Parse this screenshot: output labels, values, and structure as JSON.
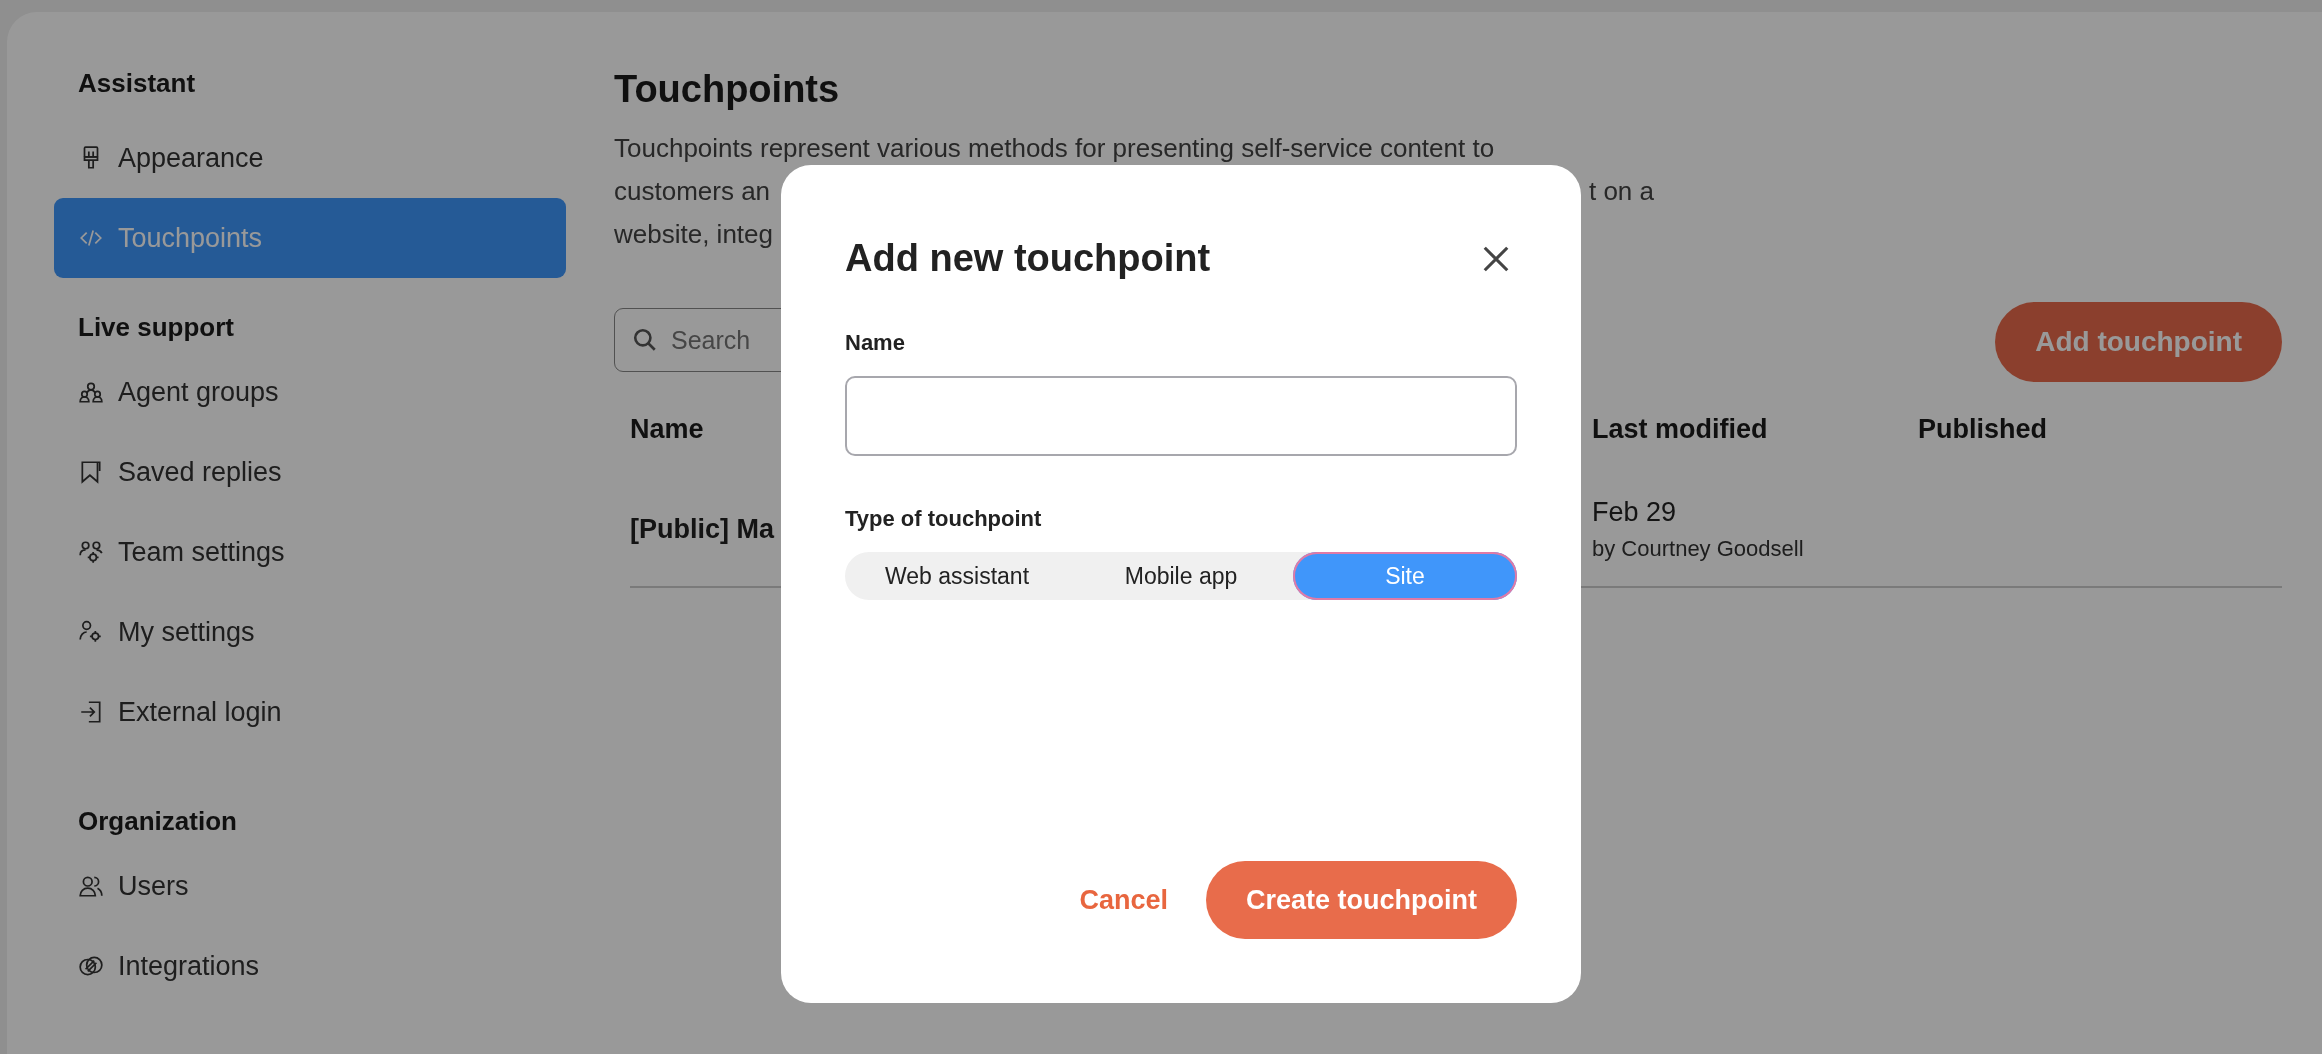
{
  "sidebar": {
    "sections": [
      {
        "title": "Assistant",
        "items": [
          {
            "label": "Appearance",
            "selected": false
          },
          {
            "label": "Touchpoints",
            "selected": true
          }
        ]
      },
      {
        "title": "Live support",
        "items": [
          {
            "label": "Agent groups",
            "selected": false
          },
          {
            "label": "Saved replies",
            "selected": false
          },
          {
            "label": "Team settings",
            "selected": false
          },
          {
            "label": "My settings",
            "selected": false
          },
          {
            "label": "External login",
            "selected": false
          }
        ]
      },
      {
        "title": "Organization",
        "items": [
          {
            "label": "Users",
            "selected": false
          },
          {
            "label": "Integrations",
            "selected": false
          }
        ]
      }
    ]
  },
  "page": {
    "title": "Touchpoints",
    "description_lines": [
      [
        "Touchpoints represent various methods for presenting self-service content to"
      ],
      [
        "customers an",
        "t on a"
      ],
      [
        "website, integ"
      ]
    ],
    "search": {
      "placeholder": "Search"
    },
    "add_button": "Add touchpoint",
    "table": {
      "columns": [
        "Name",
        "Last modified",
        "Published"
      ],
      "rows": [
        {
          "name": "[Public] Ma",
          "last_modified": "Feb 29",
          "modified_by": "by Courtney Goodsell"
        }
      ]
    }
  },
  "modal": {
    "title": "Add new touchpoint",
    "name_label": "Name",
    "type_label": "Type of touchpoint",
    "type_options": [
      {
        "label": "Web assistant",
        "selected": false
      },
      {
        "label": "Mobile app",
        "selected": false
      },
      {
        "label": "Site",
        "selected": true
      }
    ],
    "cancel": "Cancel",
    "create": "Create touchpoint"
  }
}
